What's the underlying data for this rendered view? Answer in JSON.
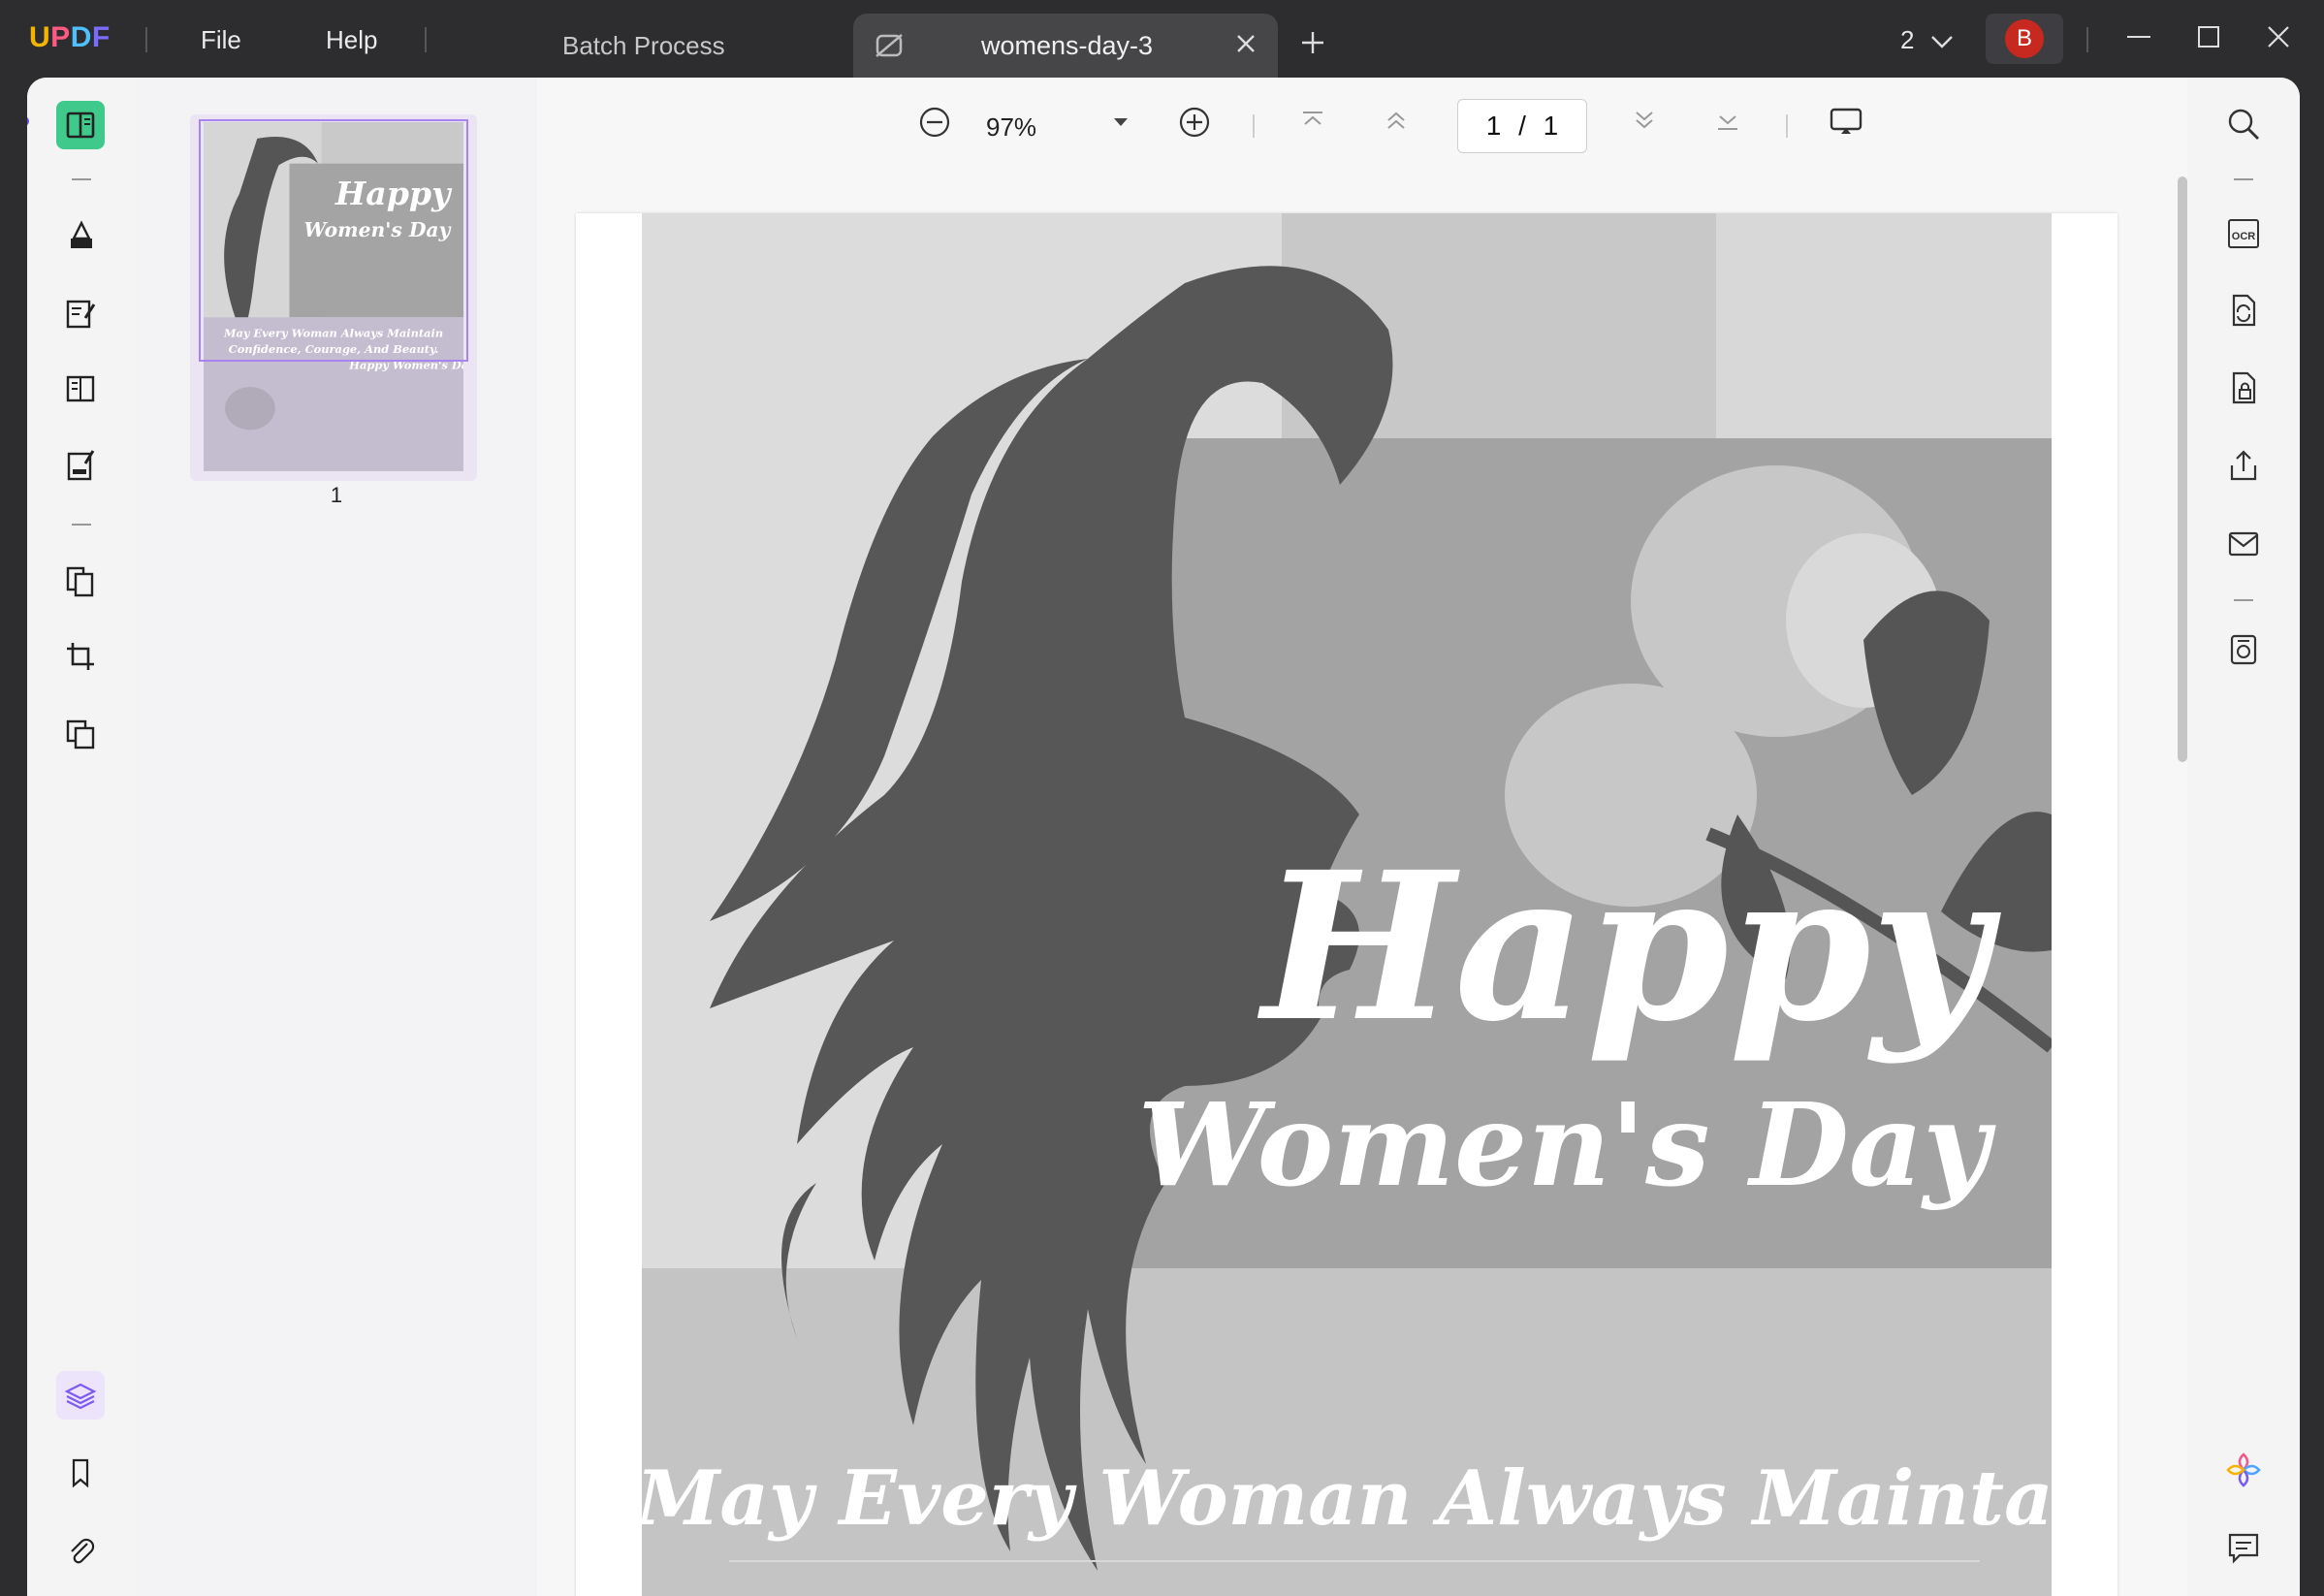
{
  "app": {
    "logo": "UPDF",
    "menu": {
      "file": "File",
      "help": "Help"
    },
    "batch_process": "Batch Process",
    "tab_title": "womens-day-3",
    "window_count": "2",
    "avatar_initial": "B"
  },
  "thumbnails": [
    {
      "page_label": "1"
    }
  ],
  "toolbar": {
    "zoom": "97%",
    "page_current": "1",
    "page_separator": "/",
    "page_total": "1"
  },
  "document": {
    "headline": "Happy",
    "subheadline": "Women's Day",
    "line1": "May Every Woman Always Maintain",
    "thumb_line1": "May Every Woman Always Maintain",
    "thumb_line2": "Confidence, Courage, And Beauty.",
    "thumb_line3": "Happy Women's Day!"
  },
  "left_rail_icons": [
    "reader-icon",
    "comment-icon",
    "edit-text-icon",
    "page-layout-icon",
    "form-icon",
    "organize-pages-icon",
    "crop-icon",
    "watermark-icon",
    "layers-icon",
    "bookmark-icon",
    "attachment-icon"
  ],
  "right_rail_icons": [
    "search-icon",
    "ocr-icon",
    "convert-icon",
    "protect-icon",
    "share-icon",
    "email-icon",
    "save-icon",
    "ai-assistant-icon",
    "chat-icon"
  ],
  "colors": {
    "accent": "#3fc98a",
    "brand_purple": "#7b5cf0",
    "avatar_bg": "#c7281f"
  }
}
